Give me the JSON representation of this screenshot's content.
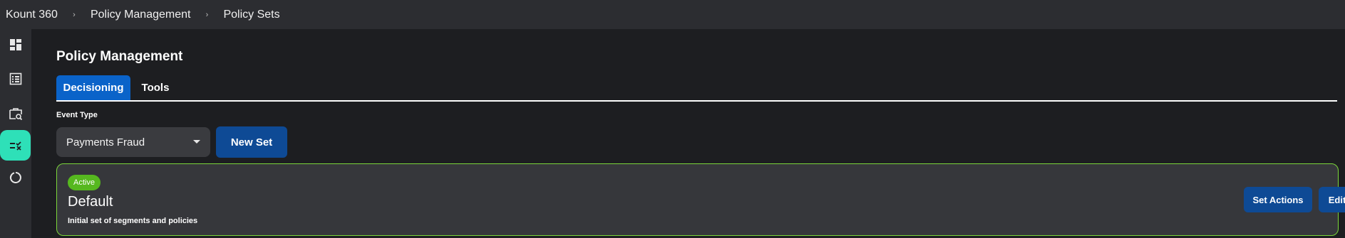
{
  "breadcrumb": {
    "items": [
      "Kount 360",
      "Policy Management",
      "Policy Sets"
    ],
    "separator": "›"
  },
  "sidebar": {
    "items": [
      {
        "icon": "dashboard-icon",
        "active": false
      },
      {
        "icon": "list-icon",
        "active": false
      },
      {
        "icon": "case-search-icon",
        "active": false
      },
      {
        "icon": "rules-icon",
        "active": true
      },
      {
        "icon": "refresh-icon",
        "active": false
      }
    ],
    "active_color": "#2ee0b8"
  },
  "page": {
    "title": "Policy Management"
  },
  "tabs": [
    {
      "label": "Decisioning",
      "active": true
    },
    {
      "label": "Tools",
      "active": false
    }
  ],
  "event_type": {
    "label": "Event Type",
    "selected": "Payments Fraud"
  },
  "buttons": {
    "new_set": "New Set",
    "set_actions": "Set Actions",
    "edit": "Edit"
  },
  "policy_set": {
    "status": "Active",
    "name": "Default",
    "description": "Initial set of segments and policies"
  },
  "colors": {
    "background": "#1d1e21",
    "chrome": "#2c2d31",
    "primary_button": "#0e4a95",
    "active_tab": "#0a63c9",
    "active_badge": "#56b81f",
    "card_border": "#7bd63a"
  }
}
